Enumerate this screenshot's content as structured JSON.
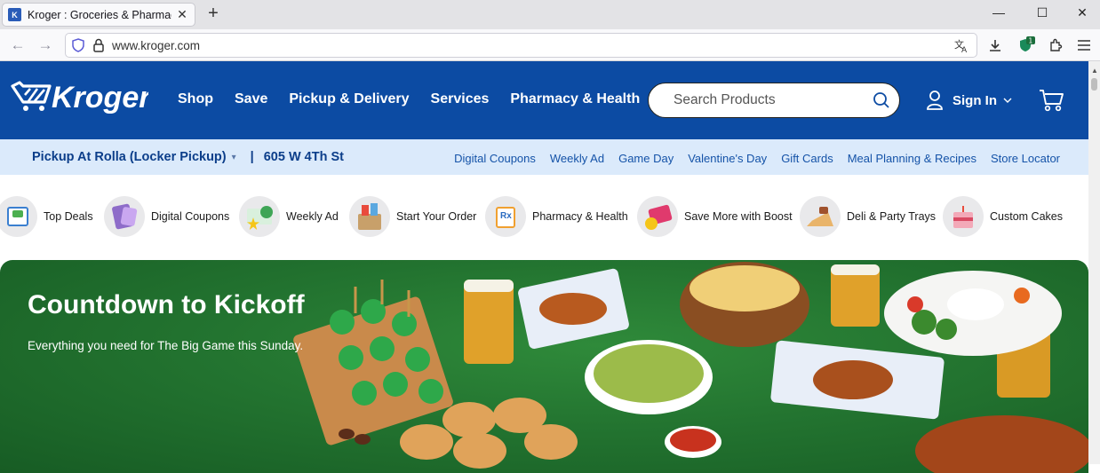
{
  "browser": {
    "tab_title": "Kroger : Groceries & Pharmacy",
    "url_domain": "www.kroger.com",
    "extension_badge": "1"
  },
  "header": {
    "logo_text": "Kroger",
    "nav": [
      "Shop",
      "Save",
      "Pickup & Delivery",
      "Services",
      "Pharmacy & Health"
    ],
    "search_placeholder": "Search Products",
    "signin_label": "Sign In"
  },
  "subbar": {
    "store_mode": "Pickup At Rolla (Locker Pickup)",
    "separator": "|",
    "store_address": "605 W 4Th St",
    "links": [
      "Digital Coupons",
      "Weekly Ad",
      "Game Day",
      "Valentine's Day",
      "Gift Cards",
      "Meal Planning & Recipes",
      "Store Locator"
    ]
  },
  "categories": [
    {
      "label": "Top Deals",
      "icon": "top-deals-icon"
    },
    {
      "label": "Digital Coupons",
      "icon": "digital-coupons-icon"
    },
    {
      "label": "Weekly Ad",
      "icon": "weekly-ad-icon"
    },
    {
      "label": "Start Your Order",
      "icon": "start-order-icon"
    },
    {
      "label": "Pharmacy & Health",
      "icon": "pharmacy-icon"
    },
    {
      "label": "Save More with Boost",
      "icon": "boost-icon"
    },
    {
      "label": "Deli & Party Trays",
      "icon": "deli-icon"
    },
    {
      "label": "Custom Cakes",
      "icon": "cake-icon"
    }
  ],
  "hero": {
    "title": "Countdown to Kickoff",
    "subtitle": "Everything you need for The Big Game this Sunday."
  },
  "colors": {
    "brand_blue": "#0c4ba3",
    "subbar_bg": "#dbeafb",
    "hero_green": "#237430"
  }
}
